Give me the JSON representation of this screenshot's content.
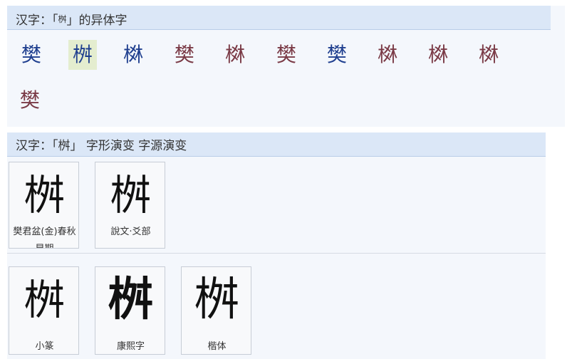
{
  "section1": {
    "title_prefix": "汉字：「",
    "title_char": "桝",
    "title_suffix": "」的异体字",
    "variants": [
      {
        "char": "樊",
        "color": "blue"
      },
      {
        "char": "桝",
        "color": "blue",
        "selected": true
      },
      {
        "char": "棥",
        "color": "blue"
      },
      {
        "char": "樊",
        "color": "red"
      },
      {
        "char": "棥",
        "color": "red"
      },
      {
        "char": "樊",
        "color": "red"
      },
      {
        "char": "樊",
        "color": "blue"
      },
      {
        "char": "棥",
        "color": "red"
      },
      {
        "char": "棥",
        "color": "red"
      },
      {
        "char": "棥",
        "color": "red"
      },
      {
        "char": "樊",
        "color": "red"
      }
    ]
  },
  "section2": {
    "title": "汉字：「桝」 字形演变 字源演变",
    "row1": [
      {
        "glyph": "桝",
        "caption": "樊君盆(金)春秋早期"
      },
      {
        "glyph": "桝",
        "caption": "說文‧爻部"
      }
    ],
    "row2": [
      {
        "glyph": "桝",
        "caption": "小篆"
      },
      {
        "glyph": "桝",
        "caption": "康熙字"
      },
      {
        "glyph": "桝",
        "caption": "楷体"
      }
    ]
  },
  "colors": {
    "header_bg": "#dbe7f7",
    "panel_bg": "#f4f7fc",
    "variant_blue": "#1f3f8f",
    "variant_red": "#7a3a46"
  }
}
